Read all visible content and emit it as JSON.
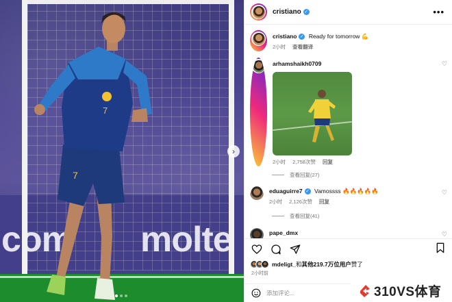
{
  "post": {
    "author": "cristiano",
    "menu_icon": "more-icon",
    "carousel": {
      "total": 3,
      "active": 1
    }
  },
  "media": {
    "ad_left": "com",
    "ad_right": "molte"
  },
  "caption": {
    "user": "cristiano",
    "text": "Ready for tomorrow 💪",
    "time": "2小时",
    "translate": "查看翻译"
  },
  "comments": [
    {
      "user": "arhamshaikh0709",
      "time": "2小时",
      "likes": "2,758次赞",
      "reply": "回复",
      "view_replies": "查看回复(27)"
    },
    {
      "user": "eduaguirre7",
      "text": "Vamossss 🔥🔥🔥🔥🔥",
      "time": "2小时",
      "likes": "2,126次赞",
      "reply": "回复",
      "view_replies": "查看回复(41)"
    },
    {
      "user": "pape_dmx"
    }
  ],
  "likes": {
    "user": "mdeligt_",
    "middle": "和",
    "others": "其他219.7万位用户",
    "suffix": "赞了"
  },
  "date": "2小时前",
  "add_comment": {
    "placeholder": "添加评论..."
  },
  "watermark": {
    "text": "310VS体育"
  },
  "colors": {
    "verified": "#3897f0",
    "muted": "#737373",
    "watermark_red": "#e33a2c"
  }
}
